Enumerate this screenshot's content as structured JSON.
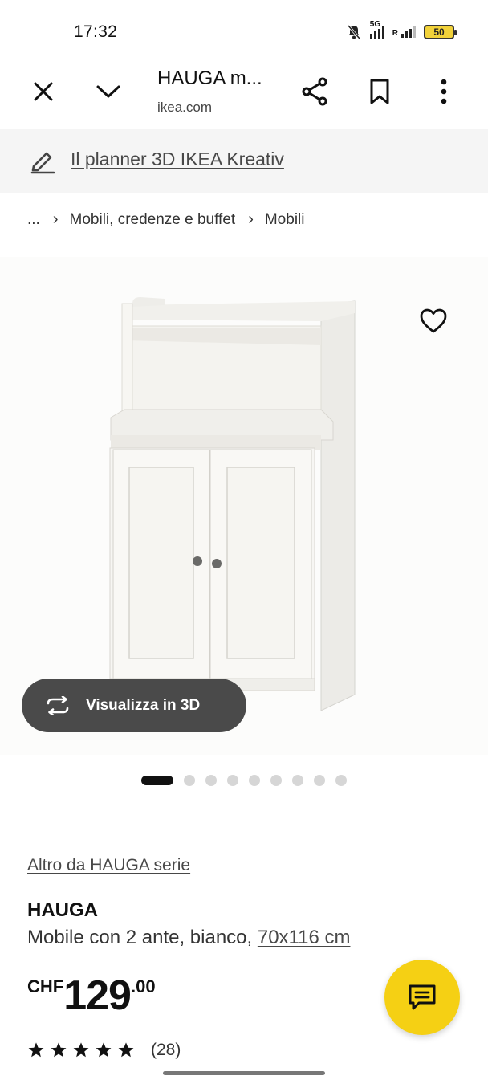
{
  "status_bar": {
    "time": "17:32",
    "network": "5G",
    "roaming": "R",
    "battery": "50",
    "icons": [
      "mute-bell-icon",
      "signal-5g-icon",
      "signal-roaming-icon",
      "battery-icon"
    ]
  },
  "browser": {
    "title": "HAUGA m...",
    "url": "ikea.com",
    "icons": [
      "close-icon",
      "chevron-down-icon",
      "share-icon",
      "bookmark-icon",
      "more-vert-icon"
    ]
  },
  "planner": {
    "label": "Il planner 3D IKEA Kreativ",
    "icon": "pencil-icon"
  },
  "breadcrumb": {
    "ellipsis": "...",
    "items": [
      "Mobili, credenze e buffet",
      "Mobili"
    ]
  },
  "media": {
    "view_3d_label": "Visualizza in 3D",
    "image_count": 9,
    "active_image": 1
  },
  "product": {
    "series_link": "Altro da HAUGA serie",
    "name": "HAUGA",
    "description": "Mobile con 2 ante, bianco, ",
    "size": "70x116 cm",
    "price": {
      "currency": "CHF",
      "integer": "129",
      "decimals": ".00"
    },
    "rating": {
      "stars": 5,
      "count": "(28)"
    }
  },
  "colors": {
    "accent_yellow": "#f5d014",
    "pill_dark": "#4a4a4a",
    "text_dark": "#111111"
  }
}
